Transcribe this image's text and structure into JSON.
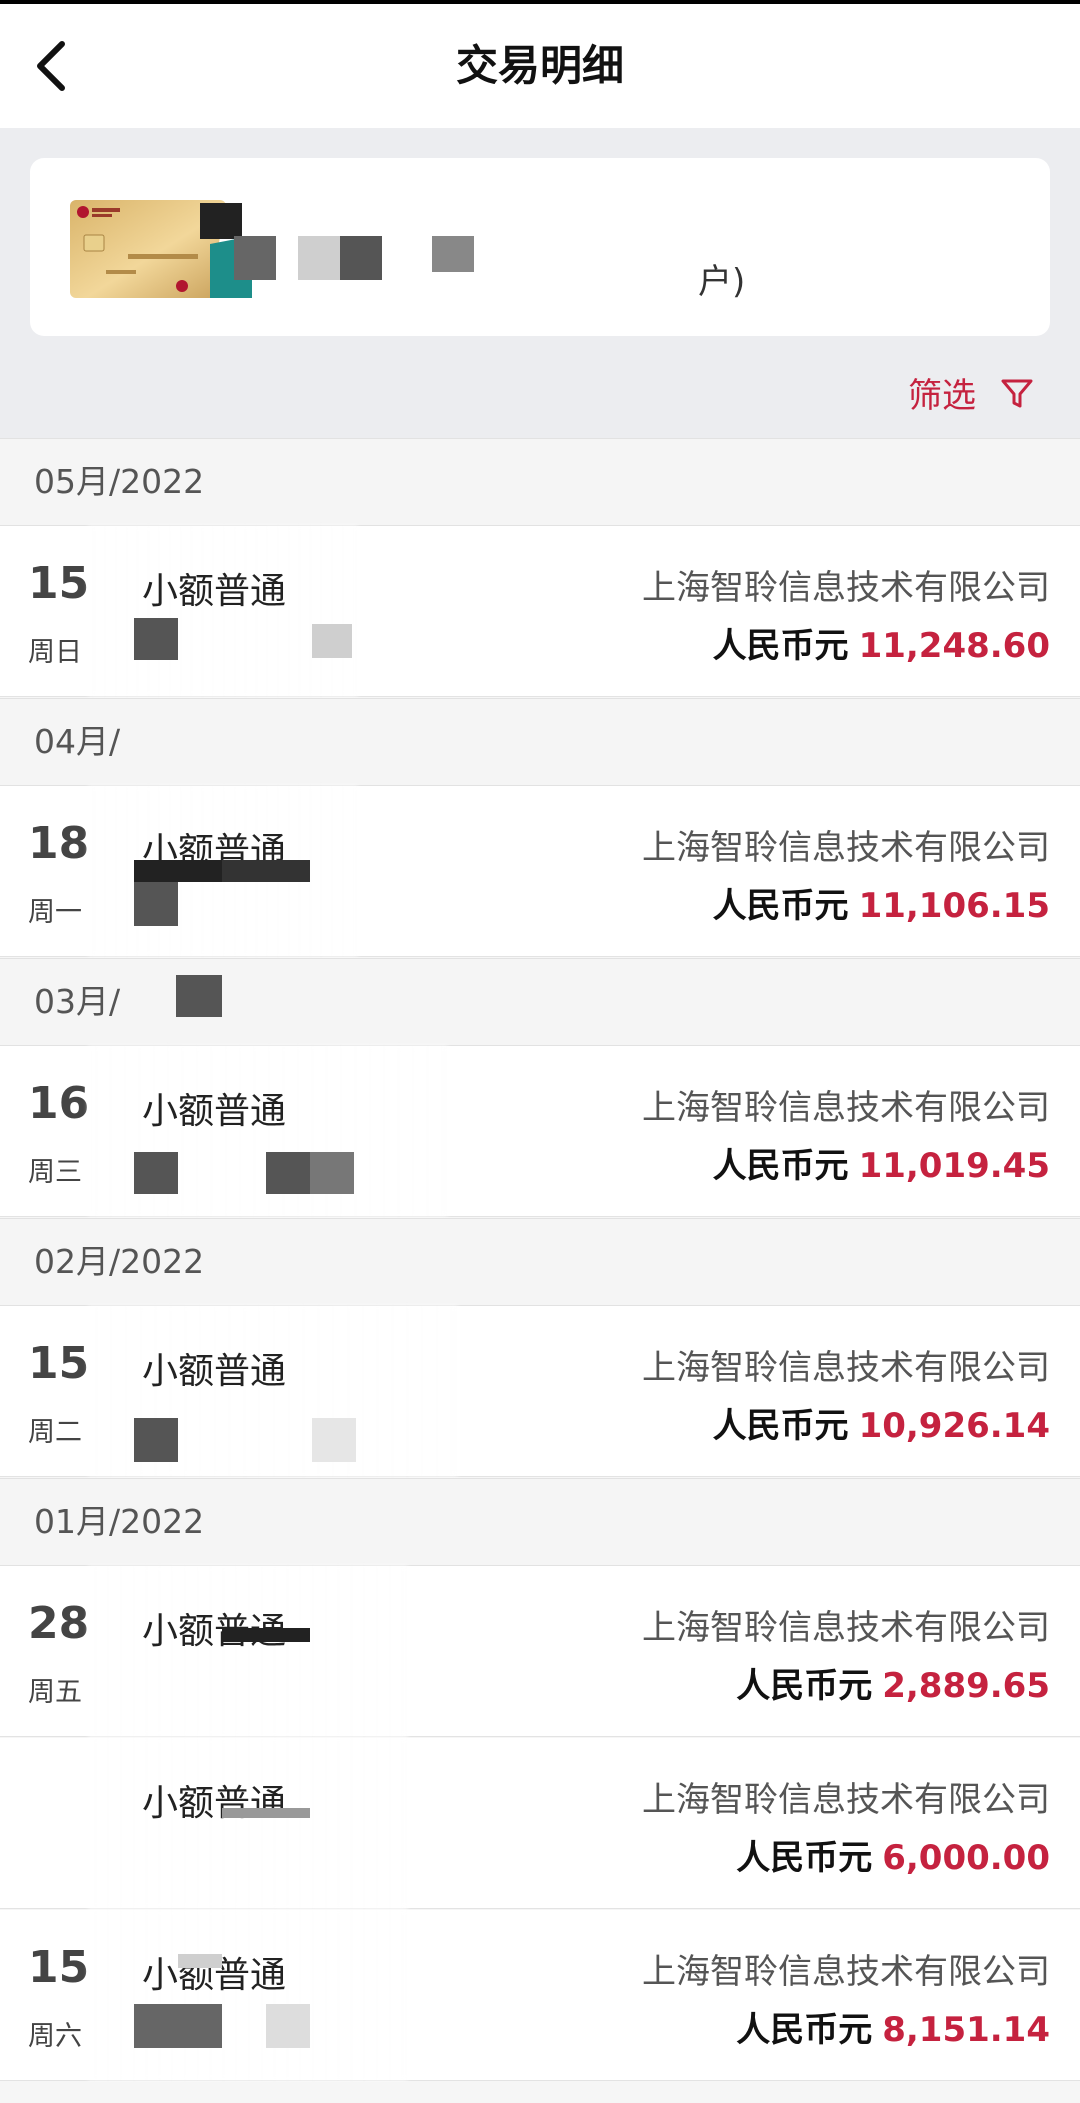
{
  "header": {
    "title": "交易明细",
    "back_icon": "chevron-left-icon"
  },
  "account": {
    "card_icon": "bank-card-icon",
    "suffix": "户)"
  },
  "filter": {
    "label": "筛选",
    "icon": "filter-icon",
    "color": "#c5223f"
  },
  "months": [
    {
      "label": "05月/2022"
    },
    {
      "label": "04月/"
    },
    {
      "label": "03月/"
    },
    {
      "label": "02月/2022"
    },
    {
      "label": "01月/2022"
    }
  ],
  "transactions": [
    {
      "day": "15",
      "weekday": "周日",
      "type": "小额普通",
      "company": "上海智聆信息技术有限公司",
      "currency": "人民币元",
      "amount": "11,248.60"
    },
    {
      "day": "18",
      "weekday": "周一",
      "type": "小额普通",
      "company": "上海智聆信息技术有限公司",
      "currency": "人民币元",
      "amount": "11,106.15"
    },
    {
      "day": "16",
      "weekday": "周三",
      "type": "小额普通",
      "company": "上海智聆信息技术有限公司",
      "currency": "人民币元",
      "amount": "11,019.45"
    },
    {
      "day": "15",
      "weekday": "周二",
      "type": "小额普通",
      "company": "上海智聆信息技术有限公司",
      "currency": "人民币元",
      "amount": "10,926.14"
    },
    {
      "day": "28",
      "weekday": "周五",
      "type": "小额普通",
      "company": "上海智聆信息技术有限公司",
      "currency": "人民币元",
      "amount": "2,889.65"
    },
    {
      "day": "",
      "weekday": "",
      "type": "小额普通",
      "company": "上海智聆信息技术有限公司",
      "currency": "人民币元",
      "amount": "6,000.00"
    },
    {
      "day": "15",
      "weekday": "周六",
      "type": "小额普通",
      "company": "上海智聆信息技术有限公司",
      "currency": "人民币元",
      "amount": "8,151.14"
    }
  ],
  "colors": {
    "accent": "#c5223f",
    "header_bg": "#ffffff",
    "summary_bg": "#ecedf0"
  }
}
